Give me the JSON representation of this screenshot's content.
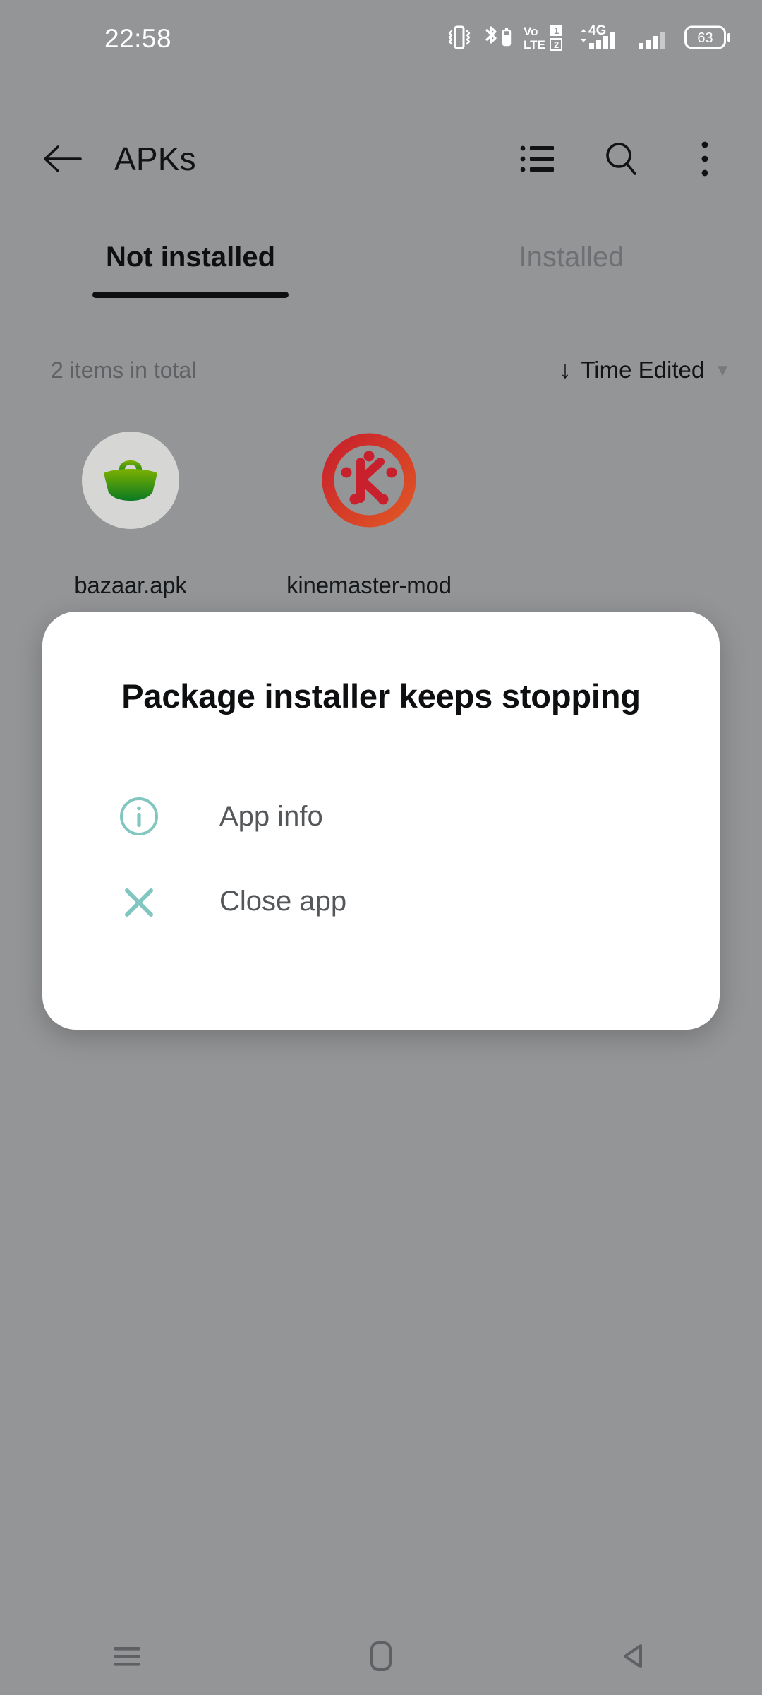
{
  "status_bar": {
    "time": "22:58",
    "icons": [
      {
        "name": "vibrate-icon"
      },
      {
        "name": "bluetooth-battery-icon"
      },
      {
        "name": "volte-dual-sim-icon",
        "line1": "Vo",
        "line2": "LTE",
        "sim1": "1",
        "sim2": "2"
      },
      {
        "name": "mobile-data-4g-icon",
        "label": "4G"
      },
      {
        "name": "signal-bars-sim2-icon"
      },
      {
        "name": "battery-icon",
        "level": "63"
      }
    ]
  },
  "app_bar": {
    "back_label": "Back",
    "title": "APKs",
    "actions": [
      {
        "name": "list-view-icon",
        "label": "List view"
      },
      {
        "name": "search-icon",
        "label": "Search"
      },
      {
        "name": "overflow-menu-icon",
        "label": "More options"
      }
    ]
  },
  "tabs": [
    {
      "label": "Not installed",
      "active": true
    },
    {
      "label": "Installed",
      "active": false
    }
  ],
  "subheader": {
    "item_count": "2 items in total",
    "sort_arrow": "↓",
    "sort_label": "Time Edited",
    "sort_caret": "▼"
  },
  "files": [
    {
      "label": "bazaar.apk",
      "icon": "bazaar-app-icon"
    },
    {
      "label": "kinemaster-mod",
      "icon": "kinemaster-app-icon"
    }
  ],
  "dialog": {
    "title": "Package installer keeps stopping",
    "actions": [
      {
        "label": "App info",
        "icon": "info-circle-icon"
      },
      {
        "label": "Close app",
        "icon": "close-x-icon"
      }
    ]
  },
  "nav_bar": [
    {
      "name": "recents-button",
      "label": "Recents"
    },
    {
      "name": "home-button",
      "label": "Home"
    },
    {
      "name": "back-button",
      "label": "Back"
    }
  ],
  "colors": {
    "scrim": "#949597",
    "dialog_bg": "#ffffff",
    "accent_teal": "#81c7c0",
    "title_text": "#0d0f11",
    "body_text": "#55585b",
    "tab_active": "#0d0f11",
    "tab_inactive": "#6e7073",
    "bazaar_green_light": "#7cb000",
    "bazaar_green_dark": "#0a7a22",
    "kinemaster_red": "#cc2229"
  }
}
